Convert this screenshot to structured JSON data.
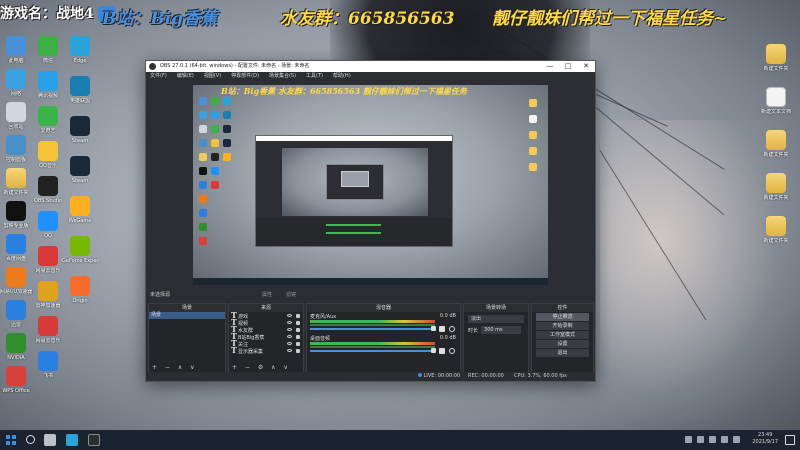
{
  "banner": {
    "game_name": "游戏名：战地4",
    "bsite": "B站：Big香蕉",
    "group": "水友群：665856563",
    "task": "靓仔靓妹们帮过一下福星任务~"
  },
  "desktop": {
    "left_icons": [
      {
        "label": "此电脑",
        "color": "#4a90d9"
      },
      {
        "label": "网络",
        "color": "#3aa0e0"
      },
      {
        "label": "回收站",
        "color": "#cfd8e0"
      },
      {
        "label": "控制面板",
        "color": "#4a8fc8"
      },
      {
        "label": "新建文件夹",
        "color": "folder"
      },
      {
        "label": "剪映专业版",
        "color": "#111"
      },
      {
        "label": "百度网盘",
        "color": "#2a7fe0"
      },
      {
        "label": "网易UU加速器",
        "color": "#ef7a1a"
      },
      {
        "label": "迅雷",
        "color": "#2a7fe0"
      },
      {
        "label": "NVIDIA",
        "color": "#2f8f2f"
      },
      {
        "label": "WPS Office",
        "color": "#d8403a"
      }
    ],
    "col2_icons": [
      {
        "label": "微信",
        "color": "#3cb045"
      },
      {
        "label": "腾讯视频",
        "color": "#2aa0e8"
      },
      {
        "label": "爱奇艺",
        "color": "#3ab34a"
      },
      {
        "label": "QQ音乐",
        "color": "#f6c23a"
      },
      {
        "label": "OBS Studio",
        "color": "#222"
      },
      {
        "label": "QQ",
        "color": "#1e90ff"
      },
      {
        "label": "网易云音乐",
        "color": "#d83a3a"
      },
      {
        "label": "雷神加速器",
        "color": "#e0a020"
      },
      {
        "label": "网易云音乐",
        "color": "#d83a3a"
      },
      {
        "label": "飞书",
        "color": "#2a7fe0"
      }
    ],
    "col3_icons": [
      {
        "label": "Edge",
        "color": "#2aa3d8"
      },
      {
        "label": "英雄联盟",
        "color": "#1a7fb0"
      },
      {
        "label": "Steam",
        "color": "#1b2838"
      },
      {
        "label": "Steam",
        "color": "#1b2838"
      },
      {
        "label": "WeGame",
        "color": "#ffb020"
      },
      {
        "label": "GeForce Experience",
        "color": "#76b900"
      },
      {
        "label": "Origin",
        "color": "#f56c2d"
      }
    ],
    "right_icons": [
      {
        "label": "新建文件夹",
        "kind": "folder"
      },
      {
        "label": "新建文本文档",
        "kind": "file"
      },
      {
        "label": "新建文件夹",
        "kind": "folder"
      },
      {
        "label": "新建文件夹",
        "kind": "folder"
      },
      {
        "label": "新建文件夹",
        "kind": "folder"
      }
    ]
  },
  "obs": {
    "title": "OBS 27.0.1 (64-bit, windows) - 配置文件: 未命名 - 场景: 未命名",
    "win_min": "—",
    "win_max": "□",
    "win_close": "✕",
    "menu": [
      "文件(F)",
      "编辑(E)",
      "视图(V)",
      "停靠部件(D)",
      "场景集合(S)",
      "工具(T)",
      "帮助(H)"
    ],
    "preview_banner": "B站：Big香蕉  水友群：665856563  靓仔靓妹们帮过一下福星任务",
    "current_scene": "未选择源",
    "properties": "属性",
    "filters": "滤镜",
    "scenes": {
      "header": "场景",
      "items": [
        "场景"
      ],
      "tools": "+ − ∧ ∨"
    },
    "sources": {
      "header": "来源",
      "items": [
        "游戏",
        "视频",
        "水友群",
        "B站Big香蕉",
        "关注",
        "显示器采集"
      ],
      "tools": "+ − ⚙ ∧ ∨"
    },
    "mixer": {
      "header": "混音器",
      "channels": [
        {
          "name": "麦克风/Aux",
          "db": "0.0 dB"
        },
        {
          "name": "桌面音频",
          "db": "0.0 dB"
        }
      ]
    },
    "transitions": {
      "header": "场景转场",
      "type": "淡出",
      "duration_label": "时长",
      "duration": "300 ms"
    },
    "controls": {
      "header": "控件",
      "buttons": [
        "停止推流",
        "开始录制",
        "工作室模式",
        "设置",
        "退出"
      ]
    },
    "status": {
      "live": "LIVE: 00:00:00",
      "rec": "REC: 00:00:00",
      "cpu": "CPU: 3.7%, 60.00 fps"
    }
  },
  "taskbar": {
    "time": "23:49",
    "date": "2021/9/17"
  }
}
